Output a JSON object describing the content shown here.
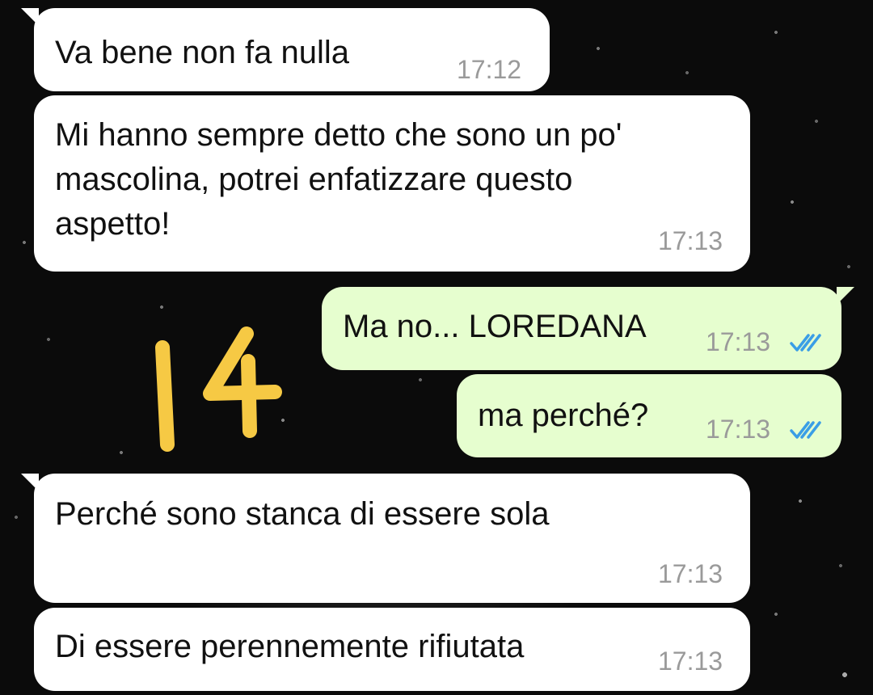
{
  "annotation": {
    "number": "14",
    "color": "#f6c944"
  },
  "messages": [
    {
      "direction": "incoming",
      "text": "Va bene non fa nulla",
      "time": "17:12"
    },
    {
      "direction": "incoming",
      "text": "Mi hanno sempre detto che sono un po'\nmascolina, potrei enfatizzare questo\naspetto!",
      "time": "17:13"
    },
    {
      "direction": "outgoing",
      "text": "Ma no... LOREDANA",
      "time": "17:13",
      "status": "read-double-check-icon"
    },
    {
      "direction": "outgoing",
      "text": "ma perché?",
      "time": "17:13",
      "status": "read-double-check-icon"
    },
    {
      "direction": "incoming",
      "text": "Perché sono stanca di essere sola",
      "time": "17:13"
    },
    {
      "direction": "incoming",
      "text": "Di essere perennemente rifiutata",
      "time": "17:13"
    }
  ],
  "colors": {
    "incoming_bubble": "#ffffff",
    "outgoing_bubble": "#e6fecf",
    "read_ticks": "#3a9ee6",
    "background": "#0b0b0b"
  }
}
